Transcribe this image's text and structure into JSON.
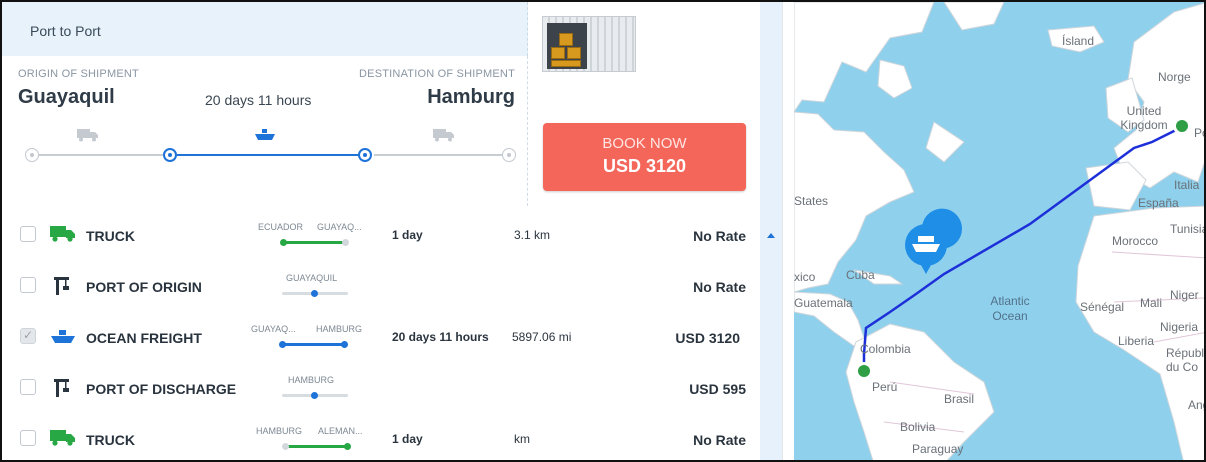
{
  "header": {
    "service_type": "Port to Port"
  },
  "shipment": {
    "origin_label": "ORIGIN OF SHIPMENT",
    "destination_label": "DESTINATION OF SHIPMENT",
    "origin_city": "Guayaquil",
    "destination_city": "Hamburg",
    "transit_time": "20 days 11 hours"
  },
  "route_icons": [
    "truck-icon",
    "ship-icon",
    "truck-icon"
  ],
  "book": {
    "label": "BOOK NOW",
    "price": "USD 3120"
  },
  "legs": [
    {
      "checked": false,
      "icon": "truck-icon",
      "name": "TRUCK",
      "from": "ECUADOR",
      "to": "GUAYAQ...",
      "duration": "1 day",
      "distance": "3.1 km",
      "rate": "No Rate"
    },
    {
      "checked": false,
      "icon": "crane-icon",
      "name": "PORT OF ORIGIN",
      "from": "GUAYAQUIL",
      "to": "",
      "duration": "",
      "distance": "",
      "rate": "No Rate"
    },
    {
      "checked": true,
      "icon": "ship-icon",
      "name": "OCEAN FREIGHT",
      "from": "GUAYAQ...",
      "to": "HAMBURG",
      "duration": "20 days 11 hours",
      "distance": "5897.06 mi",
      "rate": "USD 3120"
    },
    {
      "checked": false,
      "icon": "crane-icon",
      "name": "PORT OF DISCHARGE",
      "from": "HAMBURG",
      "to": "",
      "duration": "",
      "distance": "",
      "rate": "USD 595"
    },
    {
      "checked": false,
      "icon": "truck-icon",
      "name": "TRUCK",
      "from": "HAMBURG",
      "to": "ALEMAN...",
      "duration": "1 day",
      "distance": "km",
      "rate": "No Rate"
    }
  ],
  "map": {
    "labels": {
      "iceland": "Ísland",
      "norway": "Norge",
      "uk": "United Kingdom",
      "poland": "Po",
      "italy": "Italia",
      "spain": "España",
      "usa": "States",
      "tunisia": "Tunisia",
      "morocco": "Morocco",
      "cuba": "Cuba",
      "mexico": "xico",
      "ocean": "Atlantic Ocean",
      "mali": "Mali",
      "niger": "Niger",
      "senegal": "Sénégal",
      "guatemala": "Guatemala",
      "nigeria": "Nigeria",
      "liberia": "Liberia",
      "colombia": "Colombia",
      "republic": "Républ du Co",
      "peru": "Perú",
      "brasil": "Brasil",
      "angola": "Ang",
      "bolivia": "Bolivia",
      "paraguay": "Paraguay"
    },
    "colors": {
      "water": "#8fd0ec",
      "land": "#ffffff",
      "route": "#1d2fd8",
      "marker": "#1e8ee6",
      "pin": "#2f9e44"
    },
    "pin_icon": "ship-icon"
  }
}
